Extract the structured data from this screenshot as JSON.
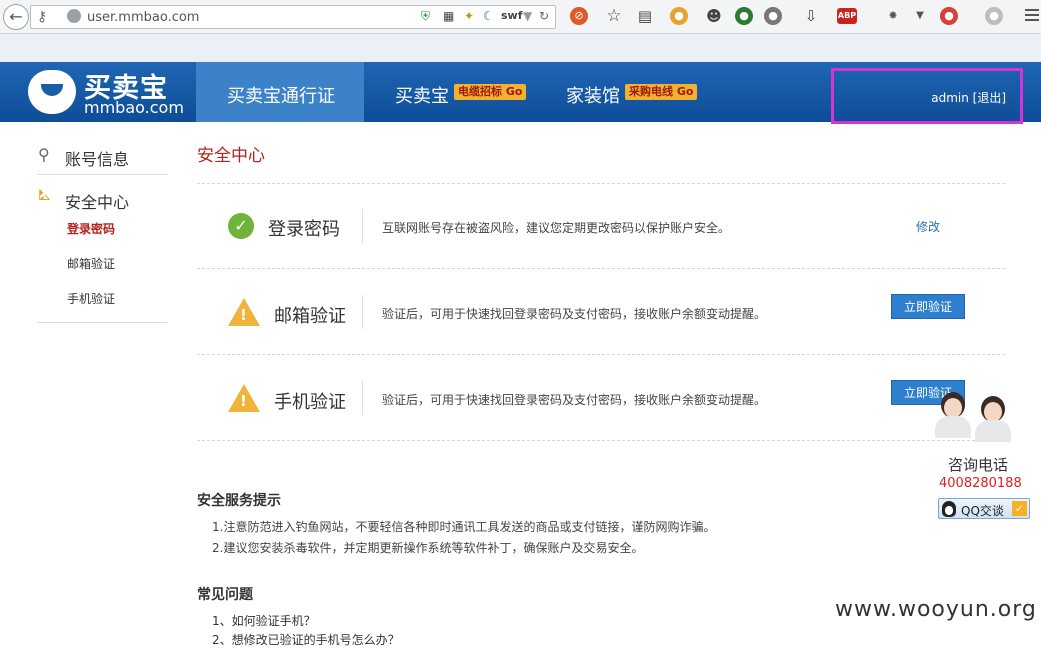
{
  "browser": {
    "url": "user.mmbao.com",
    "swf_label": "swf",
    "abp_label": "ABP"
  },
  "header": {
    "logo_cn": "买卖宝",
    "logo_en": "mmbao.com",
    "nav": [
      {
        "label": "买卖宝通行证"
      },
      {
        "label": "买卖宝",
        "badge": "电缆招标 Go"
      },
      {
        "label": "家装馆",
        "badge": "采购电线 Go"
      }
    ],
    "user": "admin [退出]"
  },
  "sidebar": {
    "account": "账号信息",
    "security": "安全中心",
    "items": [
      {
        "label": "登录密码",
        "active": true
      },
      {
        "label": "邮箱验证"
      },
      {
        "label": "手机验证"
      }
    ]
  },
  "main": {
    "title": "安全中心",
    "rows": [
      {
        "label": "登录密码",
        "status": "ok",
        "desc": "互联网账号存在被盗风险，建议您定期更改密码以保护账户安全。",
        "action": "修改"
      },
      {
        "label": "邮箱验证",
        "status": "warning",
        "desc": "验证后，可用于快速找回登录密码及支付密码，接收账户余额变动提醒。",
        "action": "立即验证"
      },
      {
        "label": "手机验证",
        "status": "warning",
        "desc": "验证后，可用于快速找回登录密码及支付密码，接收账户余额变动提醒。",
        "action": "立即验证"
      }
    ],
    "tips_title": "安全服务提示",
    "tips": [
      "1.注意防范进入钓鱼网站，不要轻信各种即时通讯工具发送的商品或支付链接，谨防网购诈骗。",
      "2.建议您安装杀毒软件，并定期更新操作系统等软件补丁，确保账户及交易安全。"
    ],
    "faq_title": "常见问题",
    "faq": [
      "1、如何验证手机？",
      "2、想修改已验证的手机号怎么办？"
    ]
  },
  "consult": {
    "title": "咨询电话",
    "phone": "4008280188",
    "qq": "QQ交谈"
  },
  "watermark": "www.wooyun.org",
  "colors": {
    "header_blue": "#1a5ea8",
    "active_red": "#b4221f",
    "button_blue": "#2f7fcf",
    "highlight_box": "#d433d8"
  }
}
